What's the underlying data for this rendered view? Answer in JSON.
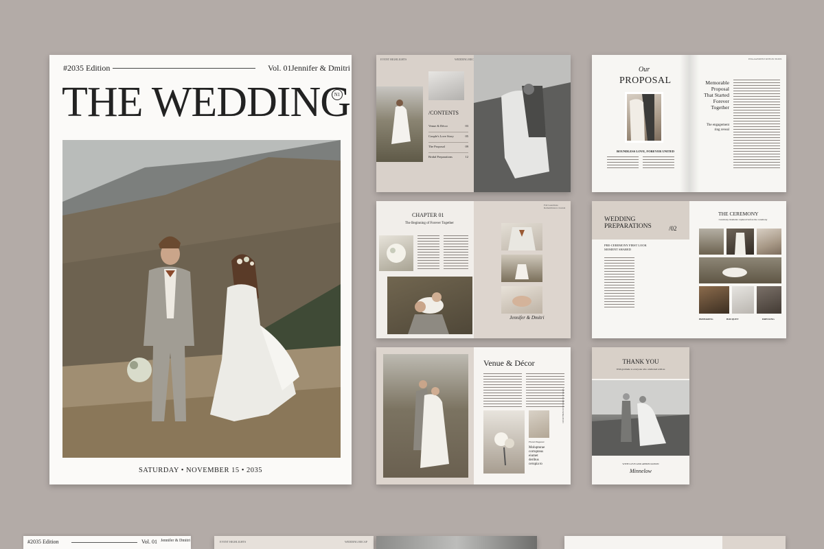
{
  "cover": {
    "edition": "#2035 Edition",
    "volume": "Vol. 01",
    "couple": "Jennifer & Dmitri",
    "title": "THE WEDDING",
    "badge": "N1",
    "date_line": "SATURDAY • NOVEMBER 15 • 2035"
  },
  "spread_contents": {
    "header_left": "EVENT HIGHLIGHTS",
    "header_right": "WEDDING RECAP",
    "contents_title": "/CONTENTS",
    "items": [
      {
        "label": "Venue & Décor",
        "page": "03"
      },
      {
        "label": "Couple's Love Story",
        "page": "05"
      },
      {
        "label": "The Proposal",
        "page": "09"
      },
      {
        "label": "Bridal Preparations",
        "page": "12"
      }
    ]
  },
  "spread_proposal": {
    "script": "Our",
    "title": "PROPOSAL",
    "caption": "BOUNDLESS LOVE, FOREVER UNITED",
    "quote_lines": [
      "Memorable",
      "Proposal",
      "That Started",
      "Forever",
      "Together"
    ],
    "subquote_lines": [
      "The engagement",
      "ring reveal"
    ],
    "header_right": "ENGAGEMENT REFLECTIONS"
  },
  "spread_chapter": {
    "chapter": "CHAPTER 01",
    "subtitle": "The Beginning of Forever Together",
    "header_right": "Fall Guardians Remembrance Journal",
    "signature": "Jennifer & Dmitri"
  },
  "spread_prep": {
    "title_line1": "WEDDING",
    "title_line2": "PREPARATIONS",
    "number": "/02",
    "subhead_line1": "PRE-CEREMONY FIRST LOOK",
    "subhead_line2": "MOMENT SHARED",
    "ceremony_title": "THE CEREMONY",
    "ceremony_sub": "Ceremony moments captured before the ceremony",
    "labels": [
      "PREPARING",
      "BOUQUET",
      "DRESSING"
    ]
  },
  "spread_venue": {
    "title": "Venue & Décor",
    "side_text": "VENUE & DECOR INSPIRATION",
    "note_head": "Floral Elegance",
    "quote_lines": [
      "Molupturae",
      "corrupteus",
      "eiumet",
      "deribus",
      "cerupia to"
    ]
  },
  "thankyou": {
    "title": "THANK YOU",
    "sub": "With gratitude to everyone who celebrated with us",
    "footer": "WITH LOVE AND APPRECIATION",
    "signature": "Minnelow"
  },
  "bottom_row": {
    "edition": "#2035 Edition",
    "volume": "Vol. 01",
    "couple": "Jennifer & Dmitri",
    "header_left": "EVENT HIGHLIGHTS",
    "header_right": "WEDDING RECAP"
  }
}
